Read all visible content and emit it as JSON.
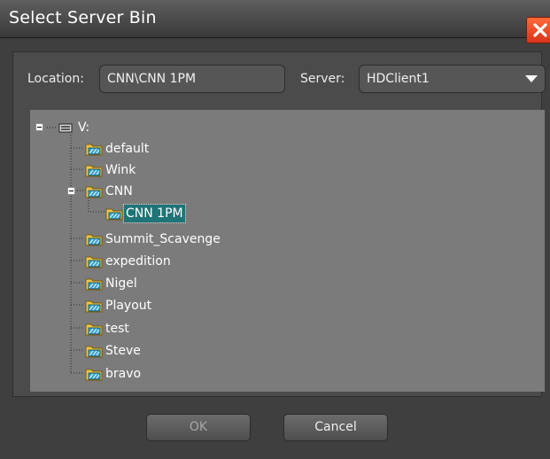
{
  "window": {
    "title": "Select Server Bin"
  },
  "location": {
    "label": "Location:",
    "value": "CNN\\CNN 1PM"
  },
  "server": {
    "label": "Server:",
    "value": "HDClient1"
  },
  "tree": {
    "root": {
      "label": "V:",
      "icon": "drive-icon",
      "expanded": true
    },
    "nodes": [
      {
        "label": "default",
        "depth": 1
      },
      {
        "label": "Wink",
        "depth": 1
      },
      {
        "label": "CNN",
        "depth": 1,
        "expanded": true
      },
      {
        "label": "CNN 1PM",
        "depth": 2,
        "selected": true
      },
      {
        "label": "Summit_Scavenge",
        "depth": 1
      },
      {
        "label": "expedition",
        "depth": 1
      },
      {
        "label": "Nigel",
        "depth": 1
      },
      {
        "label": "Playout",
        "depth": 1
      },
      {
        "label": "test",
        "depth": 1
      },
      {
        "label": "Steve",
        "depth": 1
      },
      {
        "label": "bravo",
        "depth": 1
      }
    ]
  },
  "buttons": {
    "ok_label": "OK",
    "cancel_label": "Cancel"
  },
  "colors": {
    "ok_text": "#a8a8a8",
    "cancel_text": "#f0f0f0",
    "close_button": "#e8431f",
    "selection": "#1f7477"
  }
}
